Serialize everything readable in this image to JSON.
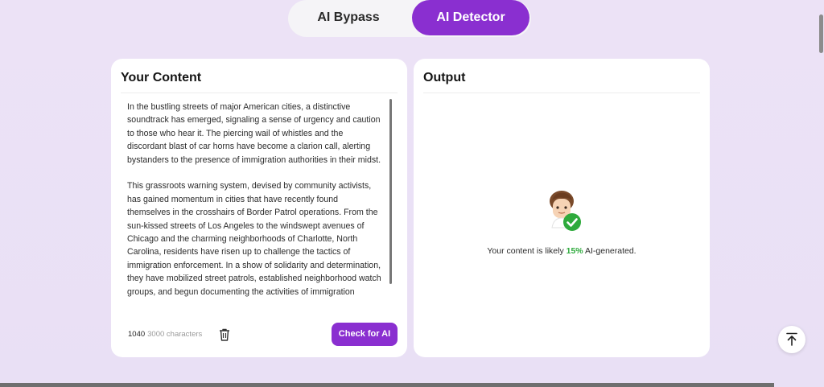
{
  "tabs": {
    "bypass_label": "AI Bypass",
    "detector_label": "AI Detector",
    "active": "AI Detector"
  },
  "input_panel": {
    "title": "Your Content",
    "paragraphs": [
      "In the bustling streets of major American cities, a distinctive soundtrack has emerged, signaling a sense of urgency and caution to those who hear it. The piercing wail of whistles and the discordant blast of car horns have become a clarion call, alerting bystanders to the presence of immigration authorities in their midst.",
      "This grassroots warning system, devised by community activists, has gained momentum in cities that have recently found themselves in the crosshairs of Border Patrol operations. From the sun-kissed streets of Los Angeles to the windswept avenues of Chicago and the charming neighborhoods of Charlotte, North Carolina, residents have risen up to challenge the tactics of immigration enforcement. In a show of solidarity and determination, they have mobilized street patrols, established neighborhood watch groups, and begun documenting the activities of immigration"
    ],
    "char_count": "1040",
    "char_limit": "3000 characters",
    "check_button": "Check for AI"
  },
  "output_panel": {
    "title": "Output",
    "result_prefix": "Your content is likely ",
    "result_percent": "15%",
    "result_suffix": " AI-generated."
  },
  "icons": {
    "delete": "trash-icon",
    "avatar": "verified-user-avatar",
    "scroll_top": "arrow-up-icon"
  },
  "colors": {
    "accent": "#8a2fd0",
    "success": "#2eaa3c",
    "background": "#ece2f6"
  }
}
